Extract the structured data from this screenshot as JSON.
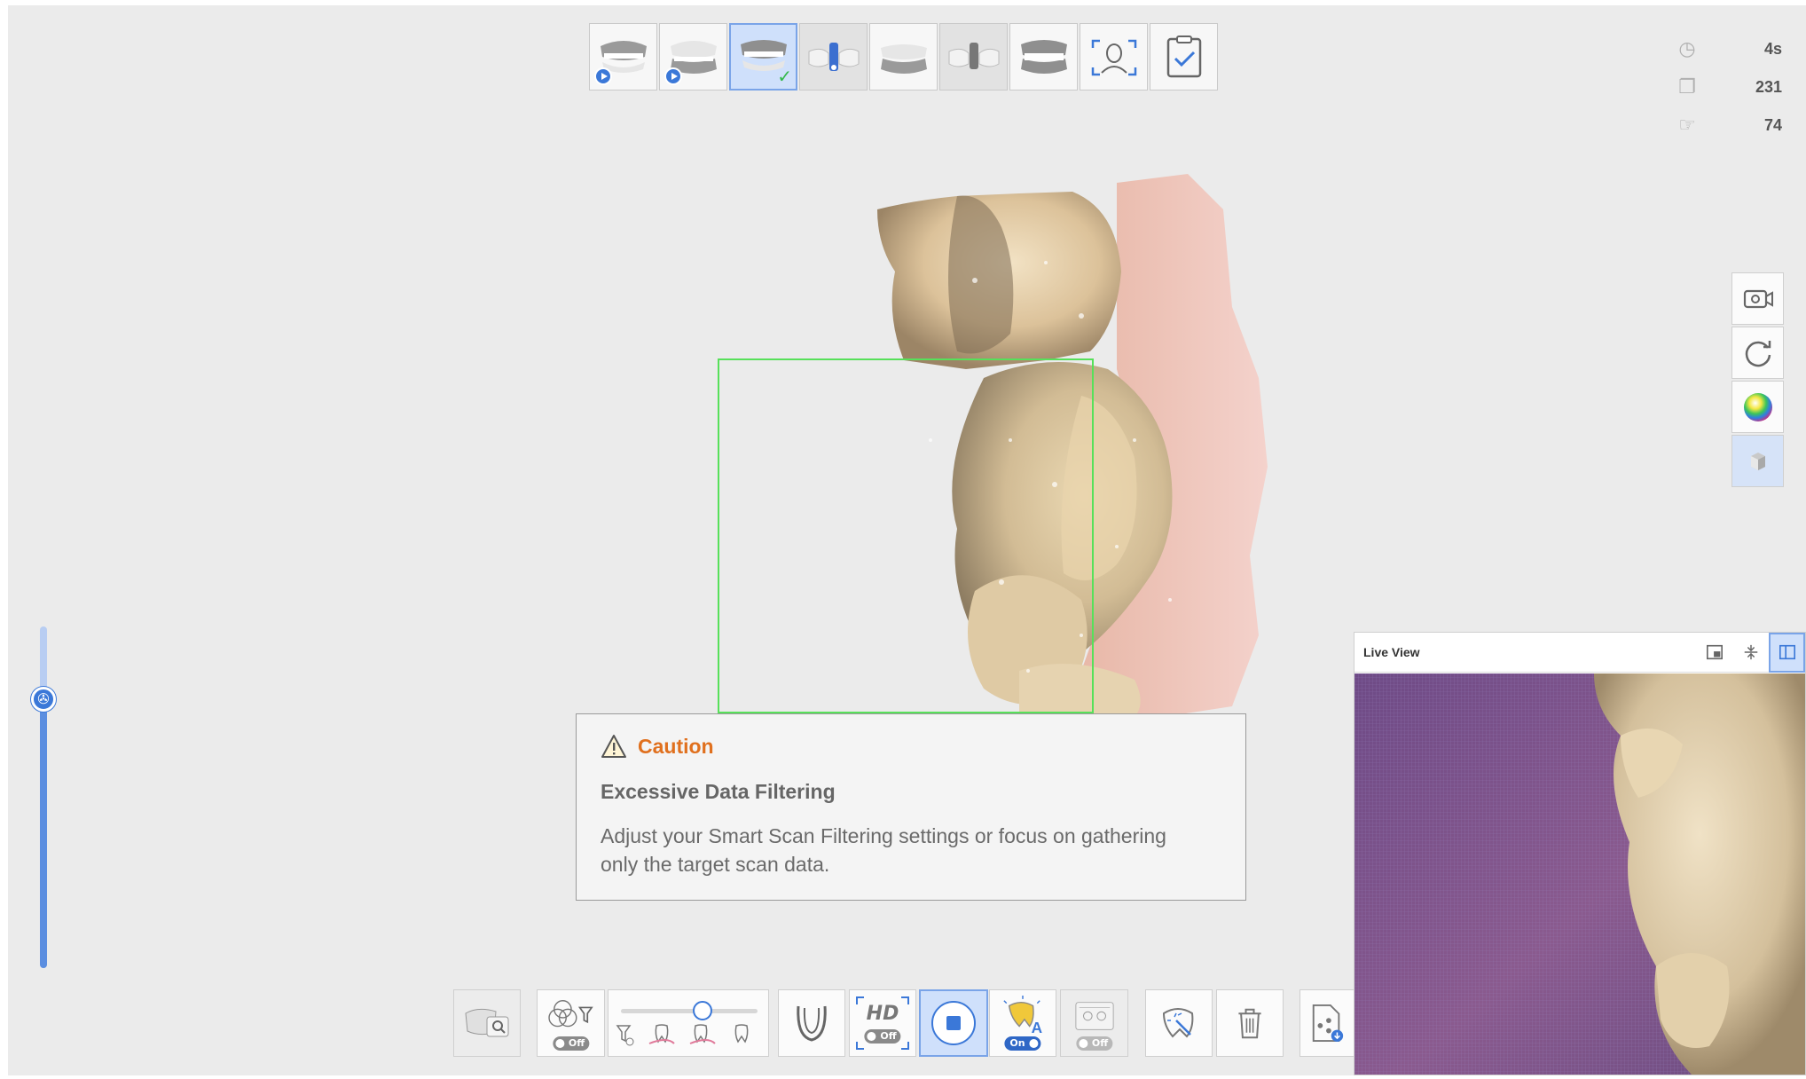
{
  "stages": [
    {
      "name": "upper-jaw-scan",
      "state": "pending"
    },
    {
      "name": "lower-jaw-scan",
      "state": "pending"
    },
    {
      "name": "lower-jaw-scan-complete",
      "state": "active-done"
    },
    {
      "name": "scanbody-upper",
      "state": "dim"
    },
    {
      "name": "occlusion-upper",
      "state": "normal"
    },
    {
      "name": "scanbody-lower",
      "state": "dim"
    },
    {
      "name": "occlusion-scan",
      "state": "normal"
    },
    {
      "name": "face-scan",
      "state": "normal"
    },
    {
      "name": "review",
      "state": "normal"
    }
  ],
  "stats": {
    "time": "4s",
    "images": "231",
    "hands": "74"
  },
  "right_tools": [
    "camera-record-icon",
    "rotate-reset-icon",
    "color-map-icon",
    "shaded-cube-icon"
  ],
  "caution": {
    "title": "Caution",
    "subtitle": "Excessive Data Filtering",
    "body": "Adjust your Smart Scan Filtering settings or focus on gathering only the target scan data."
  },
  "bottom_tools": {
    "filter_pill": "Off",
    "hd_label": "HD",
    "hd_pill": "Off",
    "ai_pill": "On",
    "compare_pill": "Off"
  },
  "filter_slider_level": 0.6,
  "live_view": {
    "title": "Live View"
  },
  "colors": {
    "accent": "#3b78d8",
    "caution": "#e0701e",
    "scan_box": "#57e05a",
    "background": "#ebebeb"
  }
}
